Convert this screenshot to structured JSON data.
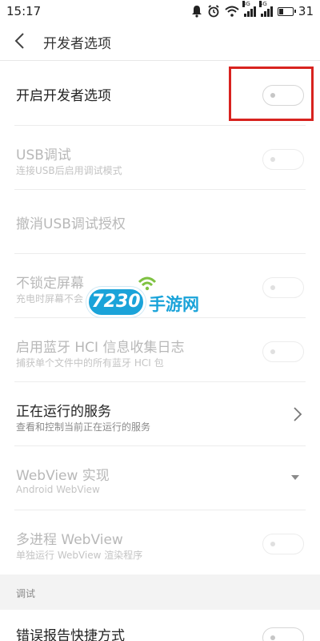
{
  "status_bar": {
    "time": "15:17",
    "signal1_tag": "3G",
    "signal2_tag": "4G",
    "battery_level": "31",
    "battery_fraction": 0.31
  },
  "app_bar": {
    "title": "开发者选项"
  },
  "rows": [
    {
      "label": "开启开发者选项",
      "sub": "",
      "control": "toggle",
      "enabled": true,
      "on": false
    },
    {
      "label": "USB调试",
      "sub": "连接USB后启用调试模式",
      "control": "toggle",
      "enabled": false,
      "on": false
    },
    {
      "label": "撤消USB调试授权",
      "sub": "",
      "control": "none",
      "enabled": false
    },
    {
      "label": "不锁定屏幕",
      "sub": "充电时屏幕不会",
      "control": "toggle",
      "enabled": false,
      "on": false
    },
    {
      "label": "启用蓝牙 HCI 信息收集日志",
      "sub": "捕获单个文件中的所有蓝牙 HCI 包",
      "control": "toggle",
      "enabled": false,
      "on": false
    },
    {
      "label": "正在运行的服务",
      "sub": "查看和控制当前正在运行的服务",
      "control": "chevron",
      "enabled": true
    },
    {
      "label": "WebView 实现",
      "sub": "Android WebView",
      "control": "dropdown",
      "enabled": false
    },
    {
      "label": "多进程 WebView",
      "sub": "单独运行 WebView 渲染程序",
      "control": "toggle",
      "enabled": false,
      "on": false
    }
  ],
  "section_header": "调试",
  "bottom_row": {
    "label": "错误报告快捷方式",
    "control": "toggle",
    "on": false
  },
  "watermark": {
    "badge": "7230",
    "text": "手游网"
  },
  "colors": {
    "highlight": "#d8231f",
    "watermark": "#1aa3d9",
    "disabled_text": "#b8b8b8"
  }
}
